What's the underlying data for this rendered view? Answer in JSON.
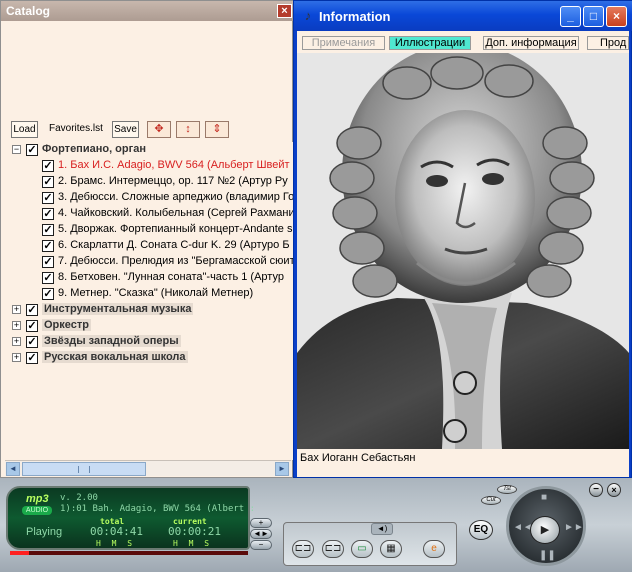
{
  "catalog": {
    "title": "Catalog",
    "close_icon": "×",
    "toolbar": {
      "load_label": "Load",
      "file_label": "Favorites.lst",
      "save_label": "Save",
      "icons": [
        "move-icon",
        "move-vertical-icon",
        "collapse-icon"
      ]
    },
    "tree": [
      {
        "type": "group",
        "expander": "−",
        "checked": true,
        "label": "Фортепиано, орган"
      },
      {
        "type": "item",
        "checked": true,
        "active": true,
        "label": "1. Бах И.С. Adagio, BWV 564 (Альберт Швейт"
      },
      {
        "type": "item",
        "checked": true,
        "label": "2. Брамс. Интермеццо, ор. 117 №2 (Артур Ру"
      },
      {
        "type": "item",
        "checked": true,
        "label": "3. Дебюсси. Сложные арпеджио (владимир Го"
      },
      {
        "type": "item",
        "checked": true,
        "label": "4. Чайковский. Колыбельная (Сергей Рахмани"
      },
      {
        "type": "item",
        "checked": true,
        "label": "5. Дворжак. Фортепианный концерт-Andante s"
      },
      {
        "type": "item",
        "checked": true,
        "label": "6. Скарлатти Д. Соната C-dur K. 29 (Артуро Б"
      },
      {
        "type": "item",
        "checked": true,
        "label": "7. Дебюсси. Прелюдия из \"Бергамасской сюит"
      },
      {
        "type": "item",
        "checked": true,
        "label": "8. Бетховен. \"Лунная соната\"-часть 1 (Артур"
      },
      {
        "type": "item",
        "checked": true,
        "label": "9. Метнер. \"Сказка\" (Николай Метнер)"
      },
      {
        "type": "group",
        "expander": "+",
        "checked": true,
        "label": "Инструментальная музыка"
      },
      {
        "type": "group",
        "expander": "+",
        "checked": true,
        "label": "Оркестр"
      },
      {
        "type": "group",
        "expander": "+",
        "checked": true,
        "label": "Звёзды западной оперы"
      },
      {
        "type": "group",
        "expander": "+",
        "checked": true,
        "label": "Русская вокальная школа"
      }
    ],
    "scroll_left": "◄",
    "scroll_right": "►"
  },
  "info": {
    "title": "Information",
    "minimize_icon": "_",
    "maximize_icon": "□",
    "close_icon": "×",
    "tabs": [
      {
        "label": "Примечания",
        "state": "disabled"
      },
      {
        "label": "Иллюстрации",
        "state": "selected"
      },
      {
        "label": "Доп. информация",
        "state": "normal"
      },
      {
        "label": "Прод",
        "state": "normal"
      }
    ],
    "caption": "Бах Иоганн Себастьян"
  },
  "player": {
    "logo": "mp3",
    "audio_badge": "AUDIO",
    "version": "v. 2.00",
    "track": "1):01 Bah. Adagio, BWV 564 (Albert :",
    "status": "Playing",
    "total_label": "total",
    "current_label": "current",
    "total_time": "00:04:41",
    "current_time": "00:00:21",
    "hms_total": "H M S",
    "hms_current": "H M S",
    "progress_fraction": 0.08,
    "eq_label": "EQ",
    "mini_button_1": "Tst",
    "mini_button_2": "Cut",
    "colors": {
      "lcd_bg": "#0e5a30",
      "lcd_text": "#8fd8a8",
      "progress": "#ff2020"
    }
  }
}
